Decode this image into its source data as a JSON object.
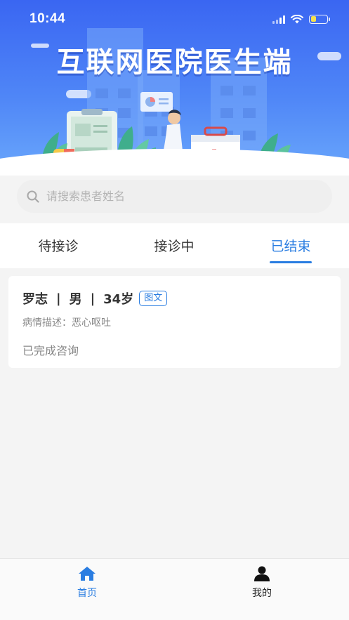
{
  "status_bar": {
    "time": "10:44"
  },
  "banner": {
    "title": "互联网医院医生端"
  },
  "search": {
    "placeholder": "请搜索患者姓名",
    "value": ""
  },
  "tabs": [
    {
      "label": "待接诊",
      "active": false
    },
    {
      "label": "接诊中",
      "active": false
    },
    {
      "label": "已结束",
      "active": true
    }
  ],
  "consultations": [
    {
      "name": "罗志",
      "gender": "男",
      "age": "34岁",
      "type_tag": "图文",
      "description": "病情描述：恶心呕吐",
      "status": "已完成咨询"
    }
  ],
  "bottom_nav": [
    {
      "label": "首页",
      "icon": "home-icon",
      "active": true
    },
    {
      "label": "我的",
      "icon": "user-icon",
      "active": false
    }
  ],
  "colors": {
    "accent": "#2a7de1",
    "banner": "#3a66f2",
    "background": "#f4f4f4"
  }
}
